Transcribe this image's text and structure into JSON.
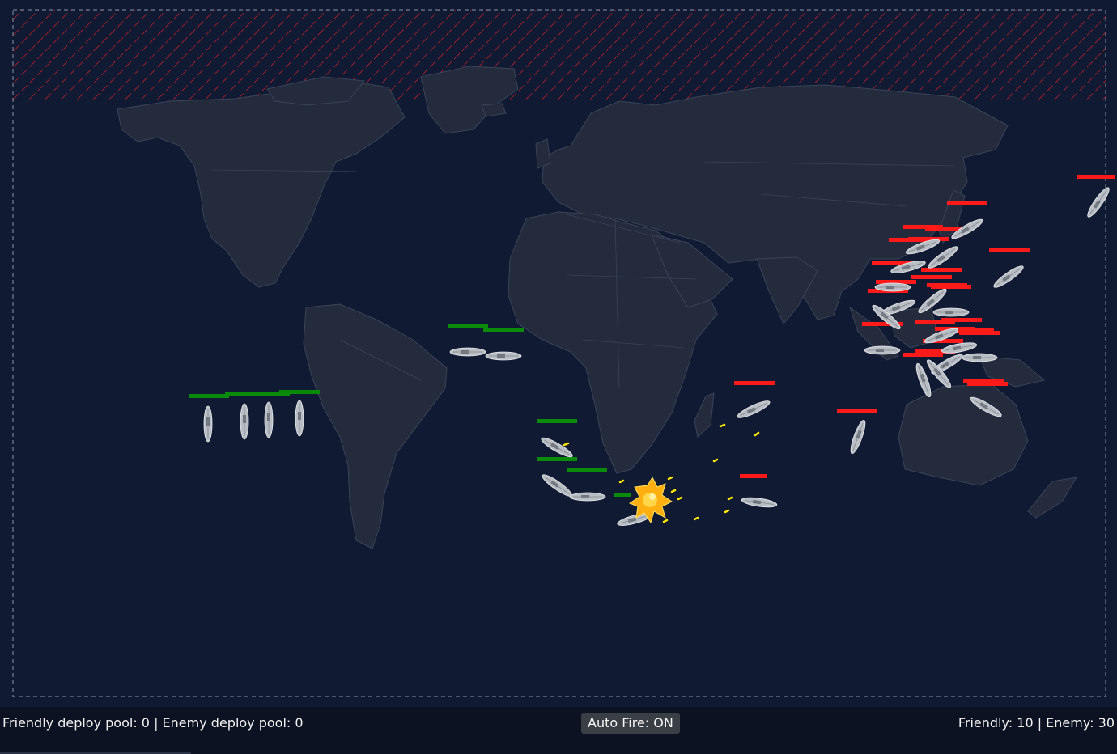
{
  "hud": {
    "pools_text": "Friendly deploy pool: 0 | Enemy deploy pool: 0",
    "auto_fire_label": "Auto Fire: ON",
    "counts_text": "Friendly: 10 | Enemy: 30"
  },
  "colors": {
    "background": "#111a33",
    "land": "#232b3c",
    "border": "#3a4458",
    "friendly": "#0a8a0a",
    "enemy": "#ff1a1a",
    "restricted_zone": "#e0202a",
    "tracer": "#ffe800",
    "explosion": "#ffb010"
  },
  "icons": {
    "ship": "warship-icon",
    "explosion": "explosion-icon"
  }
}
